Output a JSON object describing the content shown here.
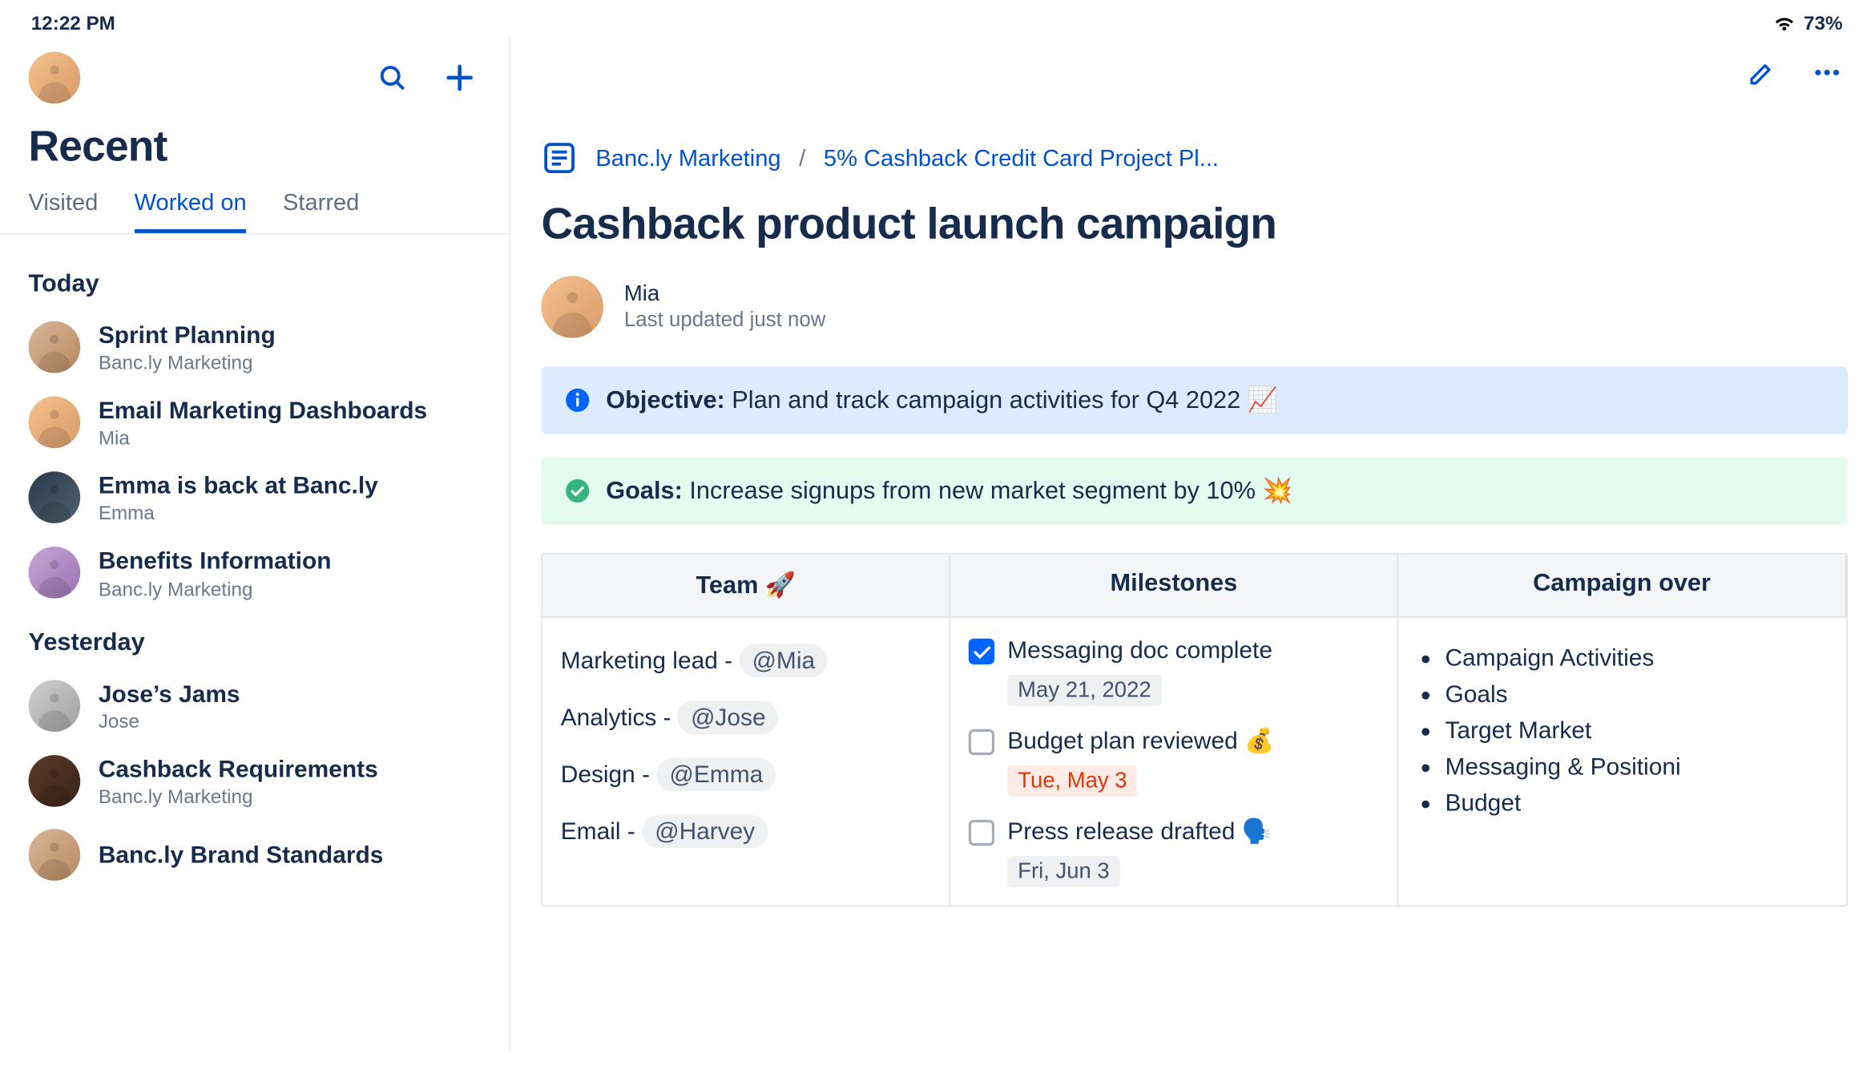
{
  "statusbar": {
    "time": "12:22 PM",
    "battery": "73%"
  },
  "sidebar": {
    "title": "Recent",
    "tabs": {
      "visited": "Visited",
      "worked_on": "Worked on",
      "starred": "Starred"
    },
    "sections": {
      "today": {
        "label": "Today",
        "items": [
          {
            "title": "Sprint Planning",
            "sub": "Banc.ly Marketing"
          },
          {
            "title": "Email Marketing Dashboards",
            "sub": "Mia"
          },
          {
            "title": "Emma is back at Banc.ly",
            "sub": "Emma"
          },
          {
            "title": "Benefits Information",
            "sub": "Banc.ly Marketing"
          }
        ]
      },
      "yesterday": {
        "label": "Yesterday",
        "items": [
          {
            "title": "Jose’s Jams",
            "sub": "Jose"
          },
          {
            "title": "Cashback Requirements",
            "sub": "Banc.ly Marketing"
          },
          {
            "title": "Banc.ly Brand Standards",
            "sub": ""
          }
        ]
      }
    }
  },
  "detail": {
    "breadcrumb": {
      "space": "Banc.ly Marketing",
      "sep": "/",
      "parent": "5% Cashback Credit Card Project Pl..."
    },
    "title": "Cashback product launch campaign",
    "author": {
      "name": "Mia",
      "sub": "Last updated just now"
    },
    "objective": {
      "label": "Objective:",
      "text": "Plan and track campaign activities for Q4 2022  📈"
    },
    "goals": {
      "label": "Goals:",
      "text": "Increase signups from new market segment by 10% 💥"
    },
    "table": {
      "headers": {
        "team": "Team 🚀",
        "milestones": "Milestones",
        "overview": "Campaign over"
      },
      "team": [
        {
          "role": "Marketing lead - ",
          "mention": "@Mia"
        },
        {
          "role": "Analytics - ",
          "mention": "@Jose"
        },
        {
          "role": "Design - ",
          "mention": "@Emma"
        },
        {
          "role": "Email - ",
          "mention": "@Harvey"
        }
      ],
      "milestones": [
        {
          "checked": true,
          "text": "Messaging doc complete",
          "date": "May 21, 2022",
          "overdue": false
        },
        {
          "checked": false,
          "text": "Budget plan reviewed 💰",
          "date": "Tue, May 3",
          "overdue": true
        },
        {
          "checked": false,
          "text": "Press release drafted 🗣️",
          "date": "Fri, Jun 3",
          "overdue": false
        }
      ],
      "overview": [
        "Campaign Activities",
        "Goals",
        "Target Market",
        "Messaging & Positioni",
        "Budget"
      ]
    }
  }
}
